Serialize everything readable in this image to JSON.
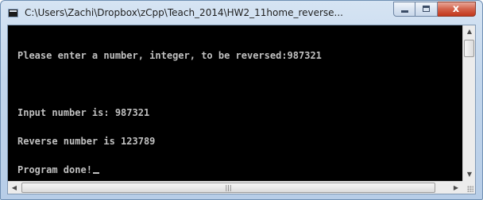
{
  "window": {
    "title": "C:\\Users\\Zachi\\Dropbox\\zCpp\\Teach_2014\\HW2_11home_reverse...",
    "close_glyph": "x"
  },
  "console": {
    "lines": [
      "Please enter a number, integer, to be reversed:987321",
      "",
      "Input number is: 987321",
      "Reverse number is 123789",
      "Program done!"
    ],
    "background": "#000000",
    "foreground": "#c0c0c0"
  },
  "icons": {
    "app": "console-app-icon",
    "minimize": "minimize-icon",
    "maximize": "maximize-icon",
    "close": "close-icon",
    "scroll_up": "up-arrow-icon",
    "scroll_down": "down-arrow-icon",
    "scroll_left": "left-arrow-icon",
    "scroll_right": "right-arrow-icon"
  }
}
